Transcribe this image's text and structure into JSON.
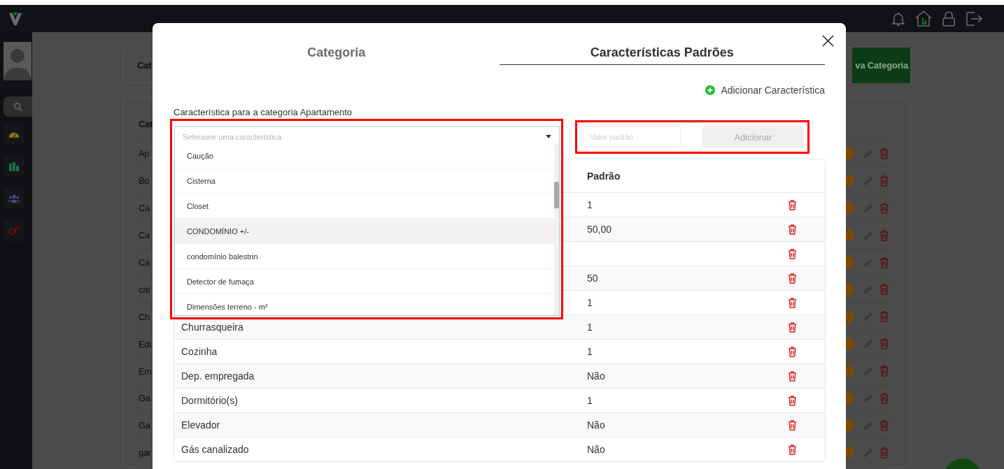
{
  "background": {
    "header_title": "Cat",
    "new_button": "va Categoria",
    "table_header": "Cat",
    "rows": [
      "Ap",
      "Bo",
      "Ca",
      "Ca",
      "Ca",
      "cat",
      "Ch",
      "Edi",
      "Em",
      "Ga",
      "Ga",
      "gar"
    ]
  },
  "modal": {
    "tabs": [
      {
        "label": "Categoria",
        "selected": false
      },
      {
        "label": "Características Padrões",
        "selected": true
      }
    ],
    "add_link": "Adicionar Característica",
    "field_label": "Característica para a categoria Apartamento",
    "select": {
      "placeholder": "Selecione uma característica",
      "expanded": true,
      "options": [
        {
          "label": "Caução",
          "highlighted": false
        },
        {
          "label": "Cisterna",
          "highlighted": false
        },
        {
          "label": "Closet",
          "highlighted": false
        },
        {
          "label": "CONDOMÍNIO +/-",
          "highlighted": true
        },
        {
          "label": "condomínio balestrin",
          "highlighted": false
        },
        {
          "label": "Detector de fumaça",
          "highlighted": false
        },
        {
          "label": "Dimensões terreno - m²",
          "highlighted": false
        }
      ]
    },
    "value_field": {
      "placeholder": "Valor padrão"
    },
    "add_button": {
      "label": "Adicionar",
      "disabled": true
    },
    "table": {
      "value_heading": "Padrão",
      "rows": [
        {
          "value": "1"
        },
        {
          "value": "50,00"
        },
        {},
        {
          "value": "50"
        },
        {
          "value": "1"
        },
        {
          "name": "Churrasqueira",
          "value": "1"
        },
        {
          "name": "Cozinha",
          "value": "1"
        },
        {
          "name": "Dep. empregada",
          "value": "Não"
        },
        {
          "name": "Dormitório(s)",
          "value": "1"
        },
        {
          "name": "Elevador",
          "value": "Não"
        },
        {
          "name": "Gás canalizado",
          "value": "Não"
        }
      ]
    }
  }
}
